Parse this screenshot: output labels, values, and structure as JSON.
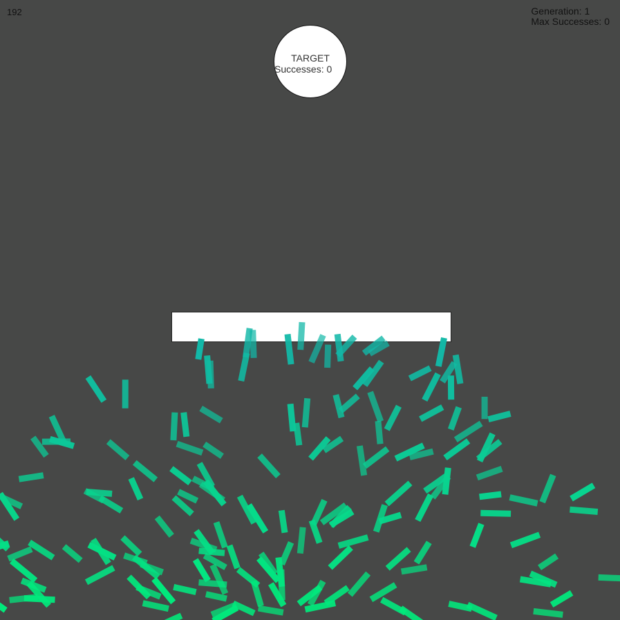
{
  "hud": {
    "frame_counter": "192",
    "generation_text": "Generation: 1",
    "max_successes_text": "Max Successes: 0"
  },
  "target": {
    "title": "TARGET",
    "successes_text": "Successes: 0"
  },
  "colors": {
    "background": "#474847",
    "target_fill": "#ffffff",
    "obstacle_fill": "#ffffff",
    "rocket_near": "#00ee7a",
    "rocket_far": "#12b8a8"
  },
  "rockets": {
    "count": 180
  }
}
